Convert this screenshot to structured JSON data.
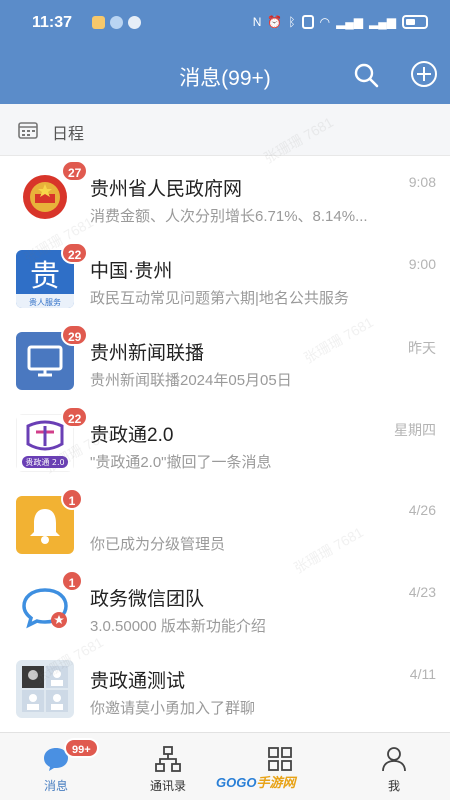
{
  "status_bar": {
    "time": "11:37"
  },
  "header": {
    "title": "消息(99+)"
  },
  "schedule": {
    "label": "日程"
  },
  "conversations": [
    {
      "name": "贵州省人民政府网",
      "message": "消费金额、人次分别增长6.71%、8.14%...",
      "time": "9:08",
      "badge": "27",
      "avatar": "emblem-icon",
      "color": "#d8352a"
    },
    {
      "name": "中国·贵州",
      "message": "政民互动常见问题第六期|地名公共服务",
      "time": "9:00",
      "badge": "22",
      "avatar": "gui-character-icon",
      "color": "#2f6fc7"
    },
    {
      "name": "贵州新闻联播",
      "message": "贵州新闻联播2024年05月05日",
      "time": "昨天",
      "badge": "29",
      "avatar": "monitor-icon",
      "color": "#4a78c0"
    },
    {
      "name": "贵政通2.0",
      "message": "\"贵政通2.0\"撤回了一条消息",
      "time": "星期四",
      "badge": "22",
      "avatar": "guizhengtong-logo",
      "color": "#6a3fb5"
    },
    {
      "name": "",
      "message": "你已成为分级管理员",
      "time": "4/26",
      "badge": "1",
      "avatar": "bell-icon",
      "color": "#f2b233"
    },
    {
      "name": "政务微信团队",
      "message": "3.0.50000 版本新功能介绍",
      "time": "4/23",
      "badge": "1",
      "avatar": "chat-bubble-icon",
      "color": "#3e8fe0"
    },
    {
      "name": "贵政通测试",
      "message": "你邀请莫小勇加入了群聊",
      "time": "4/11",
      "badge": "",
      "avatar": "group-avatar",
      "color": "#dfe8f0"
    }
  ],
  "tabs": [
    {
      "label": "消息",
      "badge": "99+",
      "icon": "chat-icon"
    },
    {
      "label": "通讯录",
      "icon": "org-chart-icon"
    },
    {
      "label": "",
      "icon": "grid-icon"
    },
    {
      "label": "我",
      "icon": "person-icon"
    }
  ],
  "watermark": {
    "text": "张珊珊 7681"
  },
  "footer_logo": {
    "part1": "GOGO",
    "part2": "手游网"
  }
}
